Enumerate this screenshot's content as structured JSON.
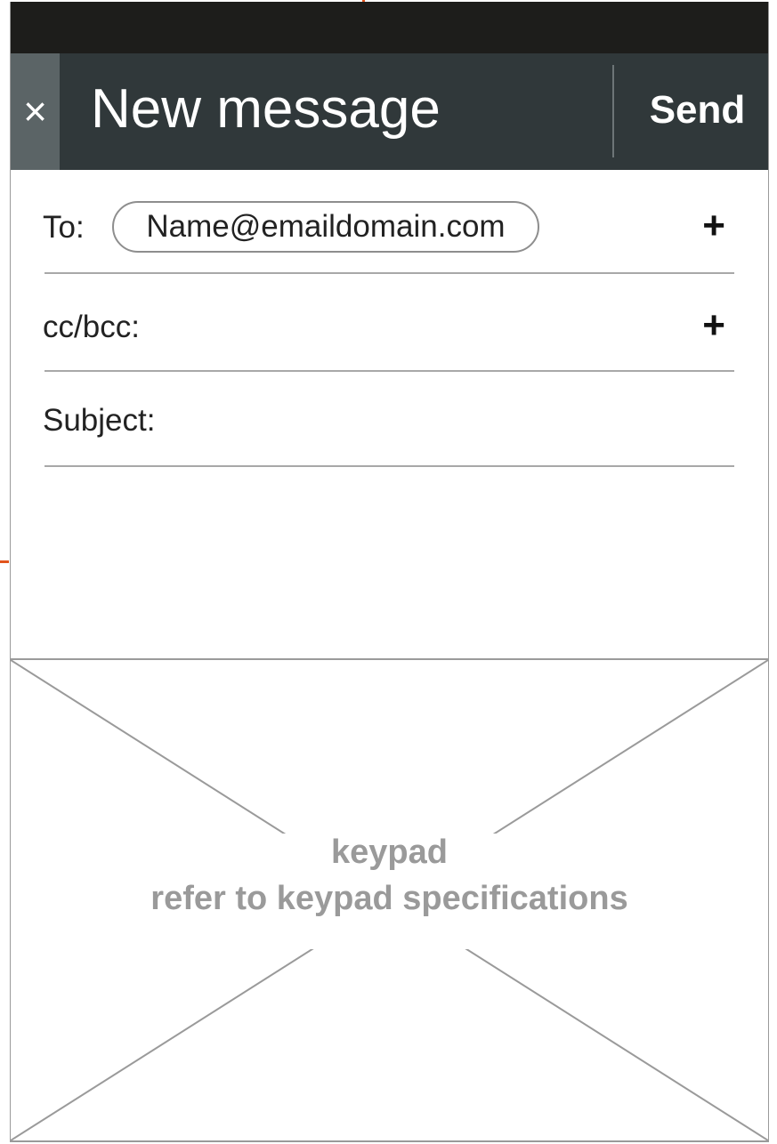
{
  "app_bar": {
    "close_glyph": "×",
    "title": "New message",
    "send_label": "Send"
  },
  "fields": {
    "to_label": "To:",
    "to_recipient": "Name@emaildomain.com",
    "cc_label": "cc/bcc:",
    "subject_label": "Subject:",
    "add_glyph": "+"
  },
  "keypad": {
    "line1": "keypad",
    "line2": "refer to keypad specifications"
  },
  "colors": {
    "status_bar": "#1d1d1b",
    "app_bar": "#30383a",
    "close_button": "#5b6466",
    "annotation_marker": "#e2541c",
    "placeholder_text": "#9a9a9a"
  },
  "icons": {
    "close": "close-icon",
    "add_recipient": "plus-icon",
    "add_cc": "plus-icon"
  }
}
